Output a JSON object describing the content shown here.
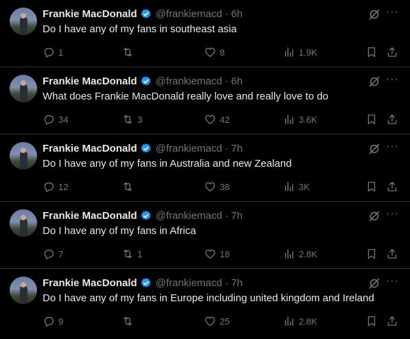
{
  "author": {
    "name": "Frankie MacDonald",
    "handle": "@frankiemacd"
  },
  "tweets": [
    {
      "time": "6h",
      "text": "Do I have any of my fans in southeast asia",
      "replies": "1",
      "retweets": "",
      "likes": "8",
      "views": "1.9K"
    },
    {
      "time": "6h",
      "text": "What does Frankie MacDonald really love and really love to do",
      "replies": "34",
      "retweets": "3",
      "likes": "42",
      "views": "3.6K"
    },
    {
      "time": "7h",
      "text": "Do I have any of my fans in Australia and new Zealand",
      "replies": "12",
      "retweets": "",
      "likes": "38",
      "views": "3K"
    },
    {
      "time": "7h",
      "text": "Do I have any of my fans in Africa",
      "replies": "7",
      "retweets": "1",
      "likes": "18",
      "views": "2.8K"
    },
    {
      "time": "7h",
      "text": "Do I have any of my fans in Europe including united kingdom and Ireland",
      "replies": "9",
      "retweets": "",
      "likes": "25",
      "views": "2.8K"
    }
  ],
  "ui": {
    "dot": "·",
    "more_glyph": "···"
  },
  "colors": {
    "background": "#000000",
    "text": "#e7e9ea",
    "muted": "#71767b",
    "verified": "#1d9bf0",
    "divider": "#2f3336"
  },
  "icons": [
    "reply-icon",
    "retweet-icon",
    "like-icon",
    "views-icon",
    "bookmark-icon",
    "share-icon",
    "grok-icon",
    "more-icon",
    "verified-badge-icon"
  ]
}
